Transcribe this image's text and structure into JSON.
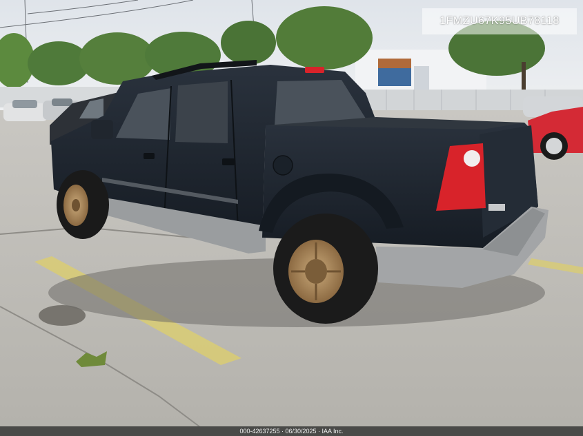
{
  "photo": {
    "vin": "1FMZU67K95UB78118",
    "footer": "000-42637255 · 06/30/2025 · IAA Inc."
  },
  "colors": {
    "sky": "#e4e8ee",
    "pavement": "#bdbcb6",
    "truck_body": "#1e2630",
    "bumper": "#a3a5a7",
    "tail_light": "#d8232a",
    "wheel_rim": "#a8865a",
    "trees": "#4f7a3a"
  }
}
